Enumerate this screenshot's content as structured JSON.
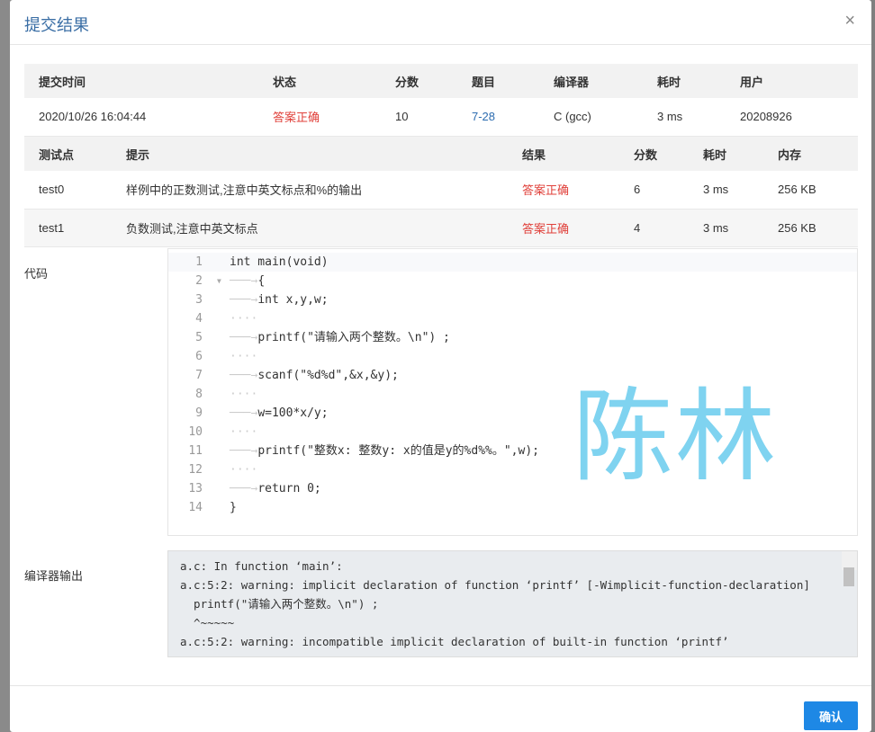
{
  "dialog": {
    "title": "提交结果",
    "close": "×",
    "confirm": "确认"
  },
  "summary": {
    "headers": [
      "提交时间",
      "状态",
      "分数",
      "题目",
      "编译器",
      "耗时",
      "用户"
    ],
    "row": {
      "time": "2020/10/26 16:04:44",
      "status": "答案正确",
      "score": "10",
      "problem": "7-28",
      "compiler": "C (gcc)",
      "elapsed": "3 ms",
      "user": "20208926"
    }
  },
  "tests": {
    "headers": [
      "测试点",
      "提示",
      "结果",
      "分数",
      "耗时",
      "内存"
    ],
    "rows": [
      {
        "id": "test0",
        "hint": "样例中的正数测试,注意中英文标点和%的输出",
        "result": "答案正确",
        "score": "6",
        "time": "3 ms",
        "memory": "256 KB"
      },
      {
        "id": "test1",
        "hint": "负数测试,注意中英文标点",
        "result": "答案正确",
        "score": "4",
        "time": "3 ms",
        "memory": "256 KB"
      }
    ]
  },
  "code": {
    "label": "代码",
    "lines": [
      "int main(void)",
      "{",
      "int x,y,w;",
      "",
      "printf(\"请输入两个整数。\\n\") ;",
      "",
      "scanf(\"%d%d\",&x,&y);",
      "",
      "w=100*x/y;",
      "",
      "printf(\"整数x: 整数y: x的值是y的%d%%。\",w);",
      "",
      "return 0;",
      "}"
    ]
  },
  "watermark": "陈林",
  "compiler_output": {
    "label": "编译器输出",
    "lines": [
      "a.c: In function ‘main’:",
      "a.c:5:2: warning: implicit declaration of function ‘printf’ [-Wimplicit-function-declaration]",
      "  printf(\"请输入两个整数。\\n\") ;",
      "  ^~~~~~",
      "a.c:5:2: warning: incompatible implicit declaration of built-in function ‘printf’"
    ]
  }
}
